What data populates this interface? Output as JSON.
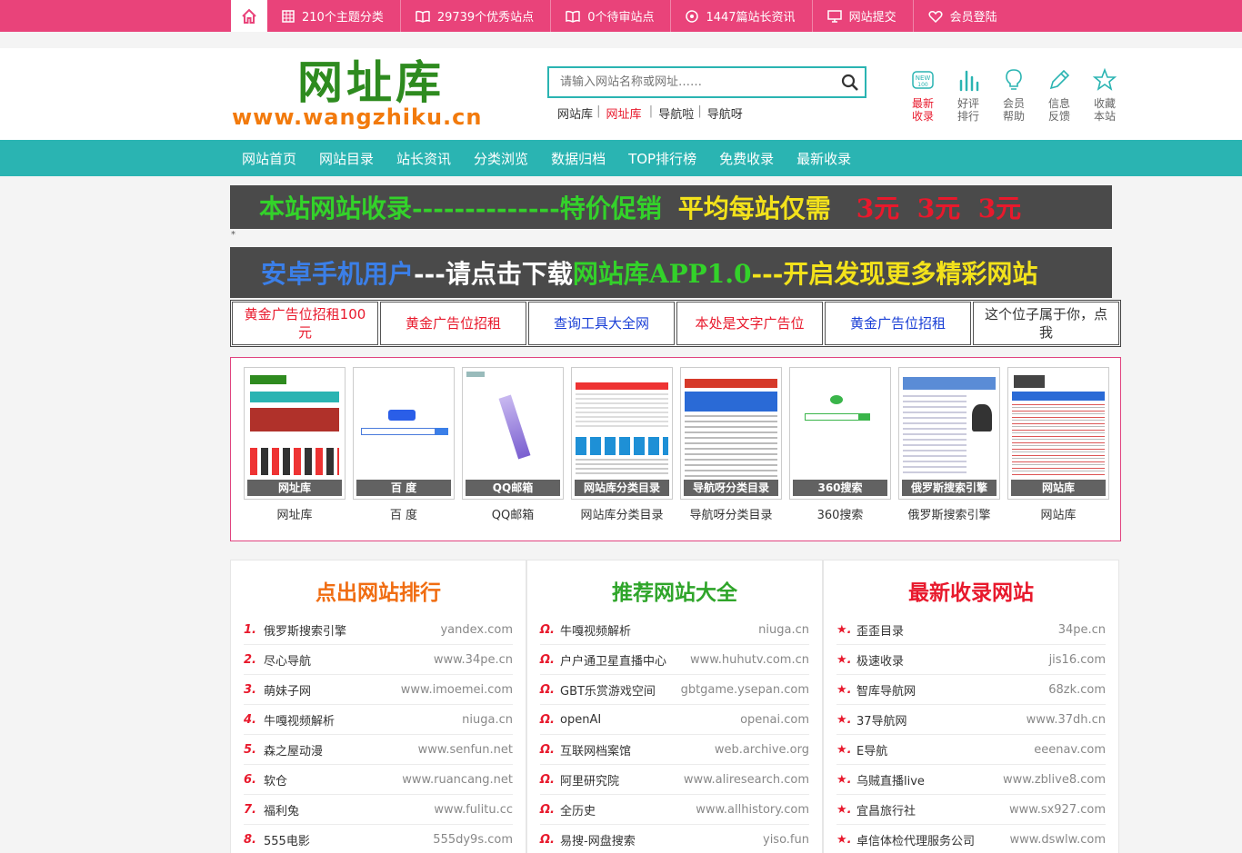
{
  "topbar": {
    "items": [
      {
        "label": "210个主题分类",
        "icon": "grid-icon"
      },
      {
        "label": "29739个优秀站点",
        "icon": "book-icon"
      },
      {
        "label": "0个待审站点",
        "icon": "book-icon"
      },
      {
        "label": "1447篇站长资讯",
        "icon": "circle-icon"
      },
      {
        "label": "网站提交",
        "icon": "monitor-icon"
      },
      {
        "label": "会员登陆",
        "icon": "heart-icon"
      }
    ]
  },
  "logo": {
    "cn": "网址库",
    "en": "www.wangzhiku.cn"
  },
  "search": {
    "placeholder": "请输入网站名称或网址……"
  },
  "quick_links": [
    "网站库",
    "网址库",
    "导航啦",
    "导航呀"
  ],
  "header_icons": [
    {
      "l1": "最新",
      "l2": "收录",
      "icon": "new-badge-icon"
    },
    {
      "l1": "好评",
      "l2": "排行",
      "icon": "bar-chart-icon"
    },
    {
      "l1": "会员",
      "l2": "帮助",
      "icon": "bulb-icon"
    },
    {
      "l1": "信息",
      "l2": "反馈",
      "icon": "pencil-icon"
    },
    {
      "l1": "收藏",
      "l2": "本站",
      "icon": "star-icon"
    }
  ],
  "nav": [
    "网站首页",
    "网站目录",
    "站长资讯",
    "分类浏览",
    "数据归档",
    "TOP排行榜",
    "免费收录",
    "最新收录"
  ],
  "banner1": {
    "a": "本站网站收录--------------",
    "b": "特价促销",
    "c": "平均每站仅需",
    "d": "3元  3元  3元"
  },
  "star_mark": "*",
  "banner2": {
    "a": "安卓手机用户",
    "b": "---请点击下载",
    "c": "网站库APP1.0",
    "d": "---开启发现更多精彩网站"
  },
  "text_ads": [
    {
      "label": "黄金广告位招租100元",
      "color": "#e8192c"
    },
    {
      "label": "黄金广告位招租",
      "color": "#e8192c"
    },
    {
      "label": "查询工具大全网",
      "color": "#1a3fd6"
    },
    {
      "label": "本处是文字广告位",
      "color": "#e8192c"
    },
    {
      "label": "黄金广告位招租",
      "color": "#1a3fd6"
    },
    {
      "label": "这个位子属于你，点我",
      "color": "#333333"
    }
  ],
  "showcase": [
    {
      "cap": "网址库",
      "label": "网址库"
    },
    {
      "cap": "百 度",
      "label": "百 度"
    },
    {
      "cap": "QQ邮箱",
      "label": "QQ邮箱"
    },
    {
      "cap": "网站库分类目录",
      "label": "网站库分类目录"
    },
    {
      "cap": "导航呀分类目录",
      "label": "导航呀分类目录"
    },
    {
      "cap": "360搜索",
      "label": "360搜索"
    },
    {
      "cap": "俄罗斯搜索引擎",
      "label": "俄罗斯搜索引擎"
    },
    {
      "cap": "网站库",
      "label": "网站库"
    }
  ],
  "columns": [
    {
      "title": "点出网站排行",
      "color": "#f06d12",
      "marker_color": "#e8192c",
      "items": [
        {
          "mk": "1.",
          "name": "俄罗斯搜索引擎",
          "url": "yandex.com"
        },
        {
          "mk": "2.",
          "name": "尽心导航",
          "url": "www.34pe.cn"
        },
        {
          "mk": "3.",
          "name": "萌妹子网",
          "url": "www.imoemei.com"
        },
        {
          "mk": "4.",
          "name": "牛嘎视频解析",
          "url": "niuga.cn"
        },
        {
          "mk": "5.",
          "name": "森之屋动漫",
          "url": "www.senfun.net"
        },
        {
          "mk": "6.",
          "name": "软仓",
          "url": "www.ruancang.net"
        },
        {
          "mk": "7.",
          "name": "福利兔",
          "url": "www.fulitu.cc"
        },
        {
          "mk": "8.",
          "name": "555电影",
          "url": "555dy9s.com"
        }
      ]
    },
    {
      "title": "推荐网站大全",
      "color": "#2fa52a",
      "marker_color": "#e8192c",
      "items": [
        {
          "mk": "Ω.",
          "name": "牛嘎视频解析",
          "url": "niuga.cn"
        },
        {
          "mk": "Ω.",
          "name": "户户通卫星直播中心",
          "url": "www.huhutv.com.cn"
        },
        {
          "mk": "Ω.",
          "name": "GBT乐赏游戏空间",
          "url": "gbtgame.ysepan.com"
        },
        {
          "mk": "Ω.",
          "name": "openAI",
          "url": "openai.com"
        },
        {
          "mk": "Ω.",
          "name": "互联网档案馆",
          "url": "web.archive.org"
        },
        {
          "mk": "Ω.",
          "name": "阿里研究院",
          "url": "www.aliresearch.com"
        },
        {
          "mk": "Ω.",
          "name": "全历史",
          "url": "www.allhistory.com"
        },
        {
          "mk": "Ω.",
          "name": "易搜-网盘搜索",
          "url": "yiso.fun"
        }
      ]
    },
    {
      "title": "最新收录网站",
      "color": "#e8192c",
      "marker_color": "#e8192c",
      "items": [
        {
          "mk": "★.",
          "name": "歪歪目录",
          "url": "34pe.cn"
        },
        {
          "mk": "★.",
          "name": "极速收录",
          "url": "jis16.com"
        },
        {
          "mk": "★.",
          "name": "智库导航网",
          "url": "68zk.com"
        },
        {
          "mk": "★.",
          "name": "37导航网",
          "url": "www.37dh.cn"
        },
        {
          "mk": "★.",
          "name": "E导航",
          "url": "eeenav.com"
        },
        {
          "mk": "★.",
          "name": "乌贼直播live",
          "url": "www.zblive8.com"
        },
        {
          "mk": "★.",
          "name": "宜昌旅行社",
          "url": "www.sx927.com"
        },
        {
          "mk": "★.",
          "name": "卓信体检代理服务公司",
          "url": "www.dswlw.com"
        }
      ]
    }
  ]
}
